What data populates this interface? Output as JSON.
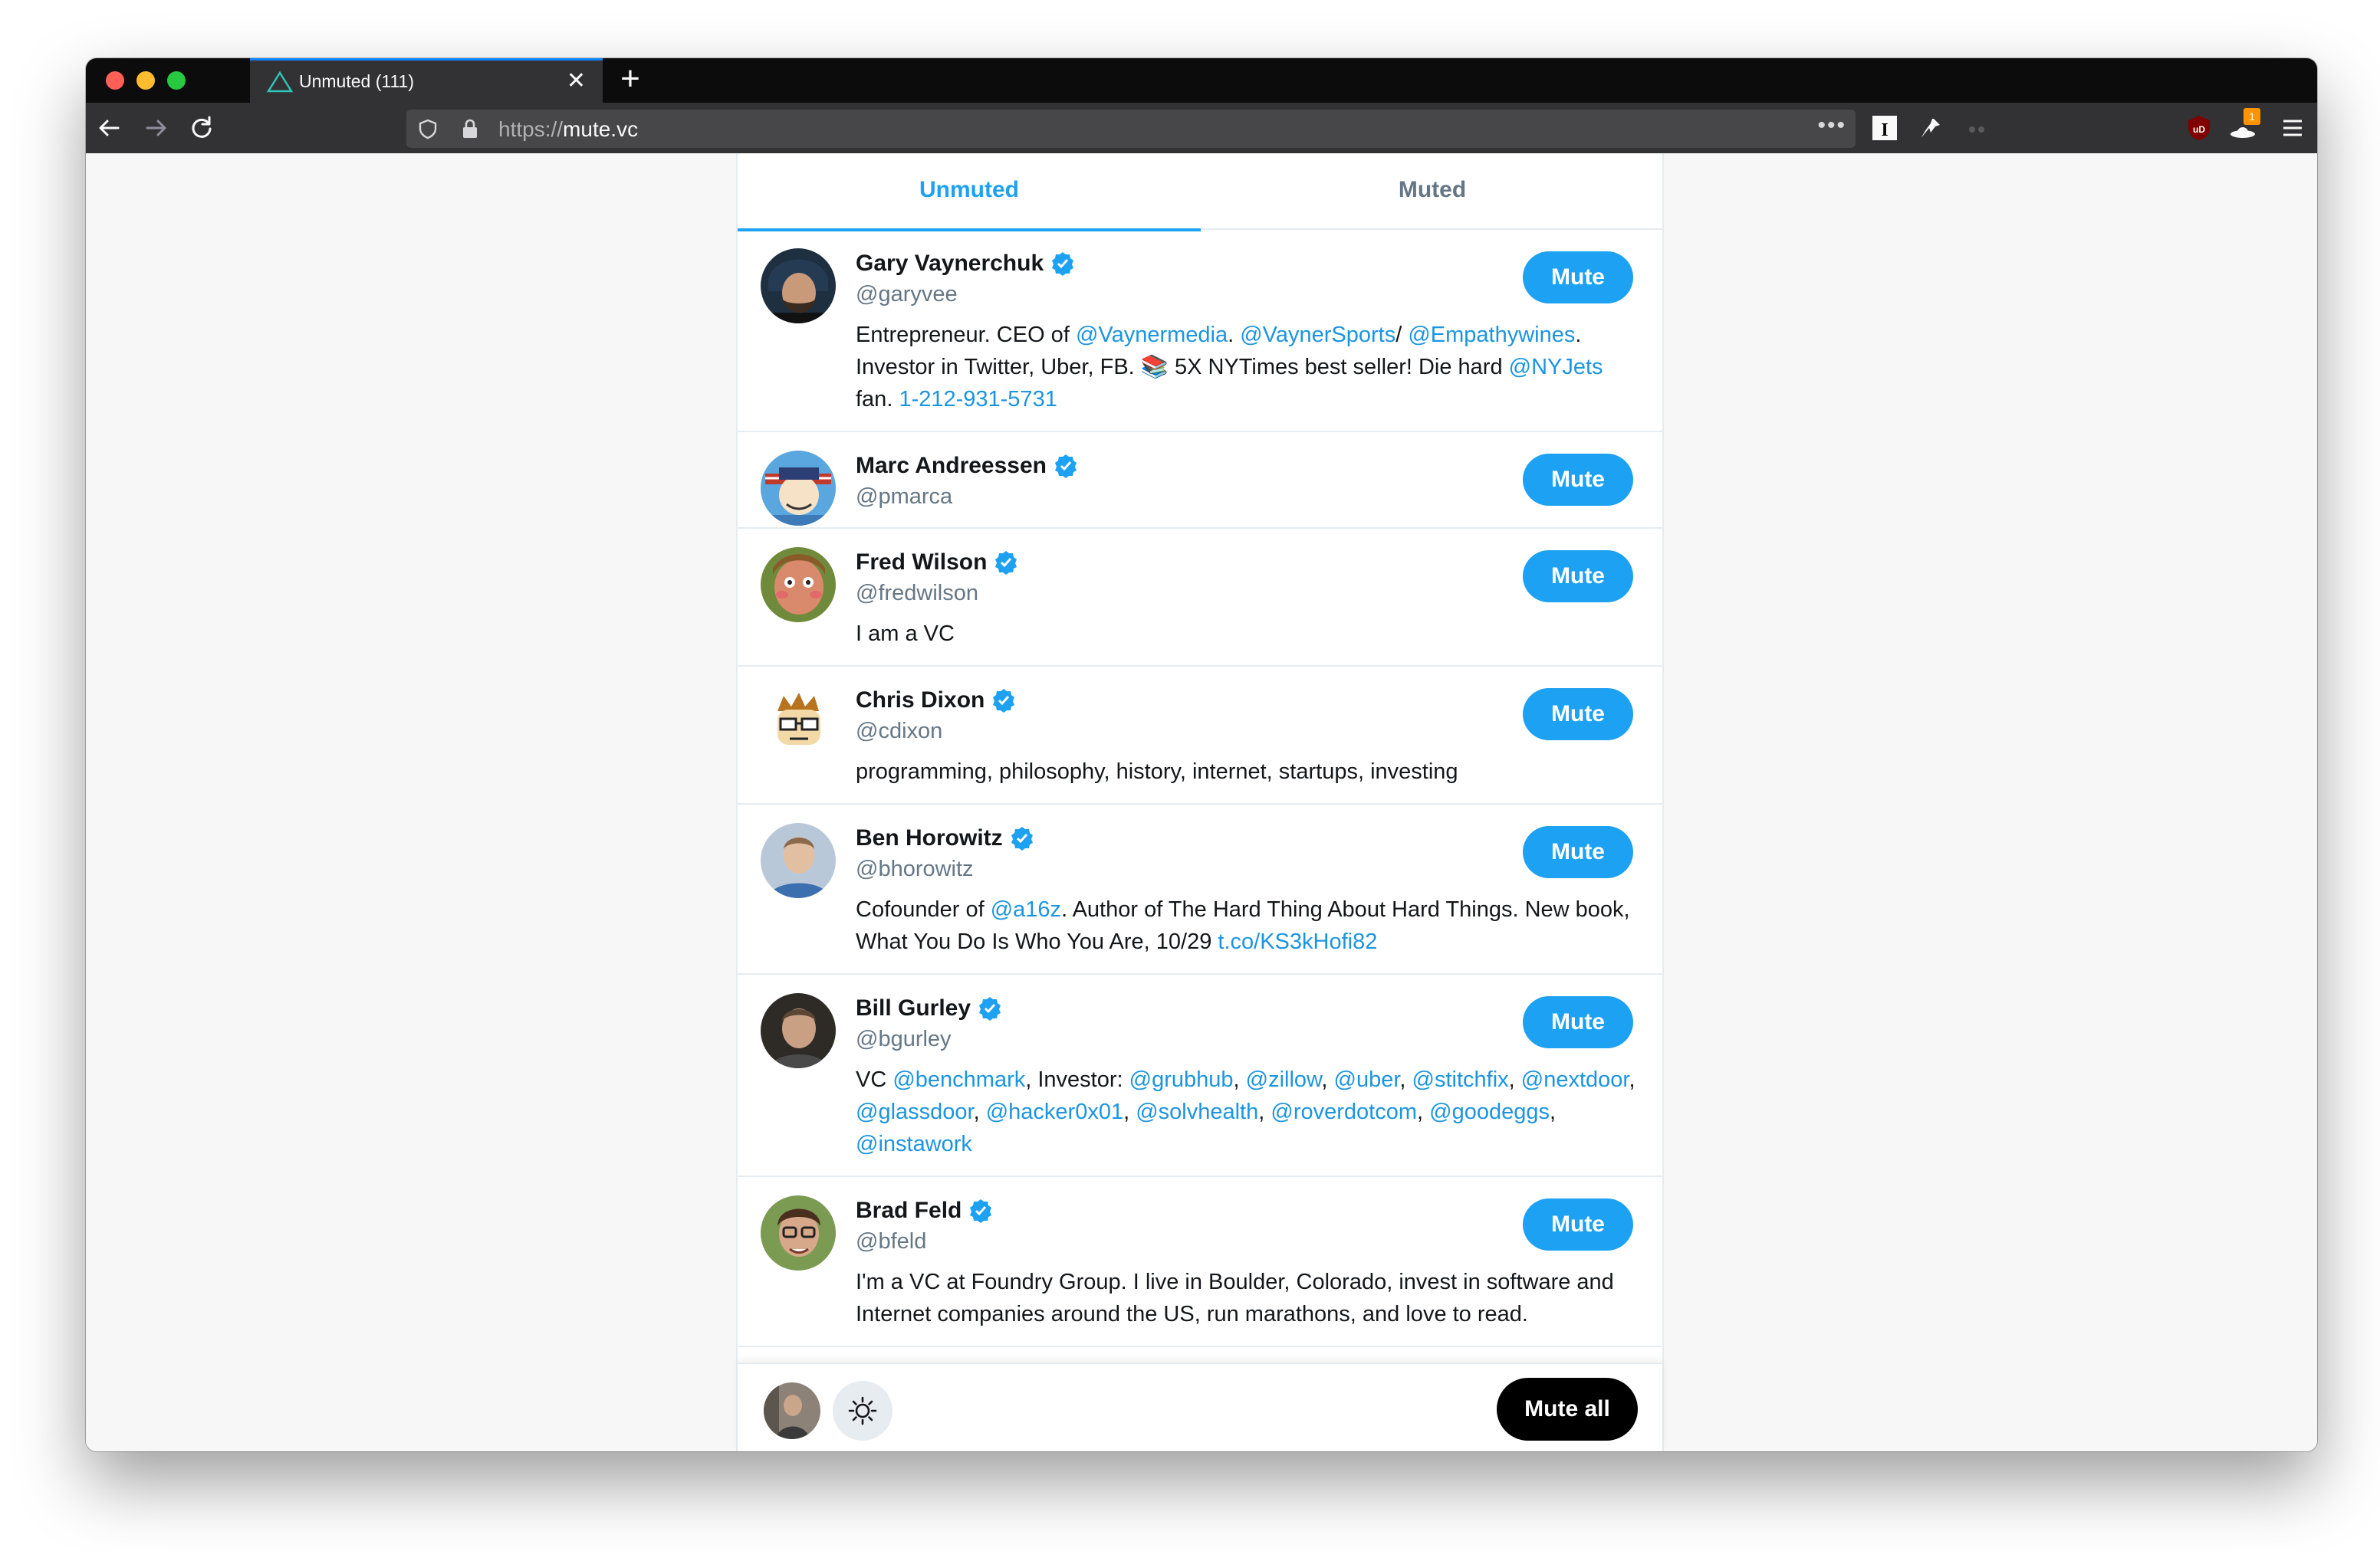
{
  "browser": {
    "tab_title": "Unmuted (111)",
    "url_protocol": "https://",
    "url_host": "mute.vc",
    "extension_badge": "1"
  },
  "tabs": {
    "unmuted_label": "Unmuted",
    "muted_label": "Muted"
  },
  "colors": {
    "accent": "#1da1f2",
    "link": "#1b95e0",
    "text": "#14171a",
    "muted_text": "#657786",
    "border": "#e6ecf0"
  },
  "users": [
    {
      "name": "Gary Vaynerchuk",
      "handle": "@garyvee",
      "button": "Mute",
      "bio": [
        {
          "text": "Entrepreneur. CEO of ",
          "link": false
        },
        {
          "text": "@Vaynermedia",
          "link": true
        },
        {
          "text": ". ",
          "link": false
        },
        {
          "text": "@VaynerSports",
          "link": true
        },
        {
          "text": "/ ",
          "link": false
        },
        {
          "text": "@Empathywines",
          "link": true
        },
        {
          "text": ". Investor in Twitter, Uber, FB. 📚 5X NYTimes best seller! Die hard ",
          "link": false
        },
        {
          "text": "@NYJets",
          "link": true
        },
        {
          "text": " fan. ",
          "link": false
        },
        {
          "text": "1-212-931-5731",
          "link": true
        }
      ]
    },
    {
      "name": "Marc Andreessen",
      "handle": "@pmarca",
      "button": "Mute",
      "bio": []
    },
    {
      "name": "Fred Wilson",
      "handle": "@fredwilson",
      "button": "Mute",
      "bio": [
        {
          "text": "I am a VC",
          "link": false
        }
      ]
    },
    {
      "name": "Chris Dixon",
      "handle": "@cdixon",
      "button": "Mute",
      "bio": [
        {
          "text": "programming, philosophy, history, internet, startups, investing",
          "link": false
        }
      ]
    },
    {
      "name": "Ben Horowitz",
      "handle": "@bhorowitz",
      "button": "Mute",
      "bio": [
        {
          "text": "Cofounder of ",
          "link": false
        },
        {
          "text": "@a16z",
          "link": true
        },
        {
          "text": ". Author of The Hard Thing About Hard Things. New book, What You Do Is Who You Are, 10/29 ",
          "link": false
        },
        {
          "text": "t.co/KS3kHofi82",
          "link": true
        }
      ]
    },
    {
      "name": "Bill Gurley",
      "handle": "@bgurley",
      "button": "Mute",
      "bio": [
        {
          "text": "VC ",
          "link": false
        },
        {
          "text": "@benchmark",
          "link": true
        },
        {
          "text": ", Investor: ",
          "link": false
        },
        {
          "text": "@grubhub",
          "link": true
        },
        {
          "text": ", ",
          "link": false
        },
        {
          "text": "@zillow",
          "link": true
        },
        {
          "text": ", ",
          "link": false
        },
        {
          "text": "@uber",
          "link": true
        },
        {
          "text": ", ",
          "link": false
        },
        {
          "text": "@stitchfix",
          "link": true
        },
        {
          "text": ", ",
          "link": false
        },
        {
          "text": "@nextdoor",
          "link": true
        },
        {
          "text": ", ",
          "link": false
        },
        {
          "text": "@glassdoor",
          "link": true
        },
        {
          "text": ", ",
          "link": false
        },
        {
          "text": "@hacker0x01",
          "link": true
        },
        {
          "text": ", ",
          "link": false
        },
        {
          "text": "@solvhealth",
          "link": true
        },
        {
          "text": ", ",
          "link": false
        },
        {
          "text": "@roverdotcom",
          "link": true
        },
        {
          "text": ", ",
          "link": false
        },
        {
          "text": "@goodeggs",
          "link": true
        },
        {
          "text": ", ",
          "link": false
        },
        {
          "text": "@instawork",
          "link": true
        }
      ]
    },
    {
      "name": "Brad Feld",
      "handle": "@bfeld",
      "button": "Mute",
      "bio": [
        {
          "text": "I'm a VC at Foundry Group. I live in Boulder, Colorado, invest in software and Internet companies around the US, run marathons, and love to read.",
          "link": false
        }
      ]
    }
  ],
  "footer": {
    "mute_all_label": "Mute all"
  },
  "icons": {
    "back": "arrow-left-icon",
    "forward": "arrow-right-icon",
    "reload": "reload-icon",
    "shield": "shield-icon",
    "lock": "lock-icon",
    "verified": "verified-badge-icon",
    "theme": "sun-icon",
    "menu": "hamburger-icon"
  }
}
